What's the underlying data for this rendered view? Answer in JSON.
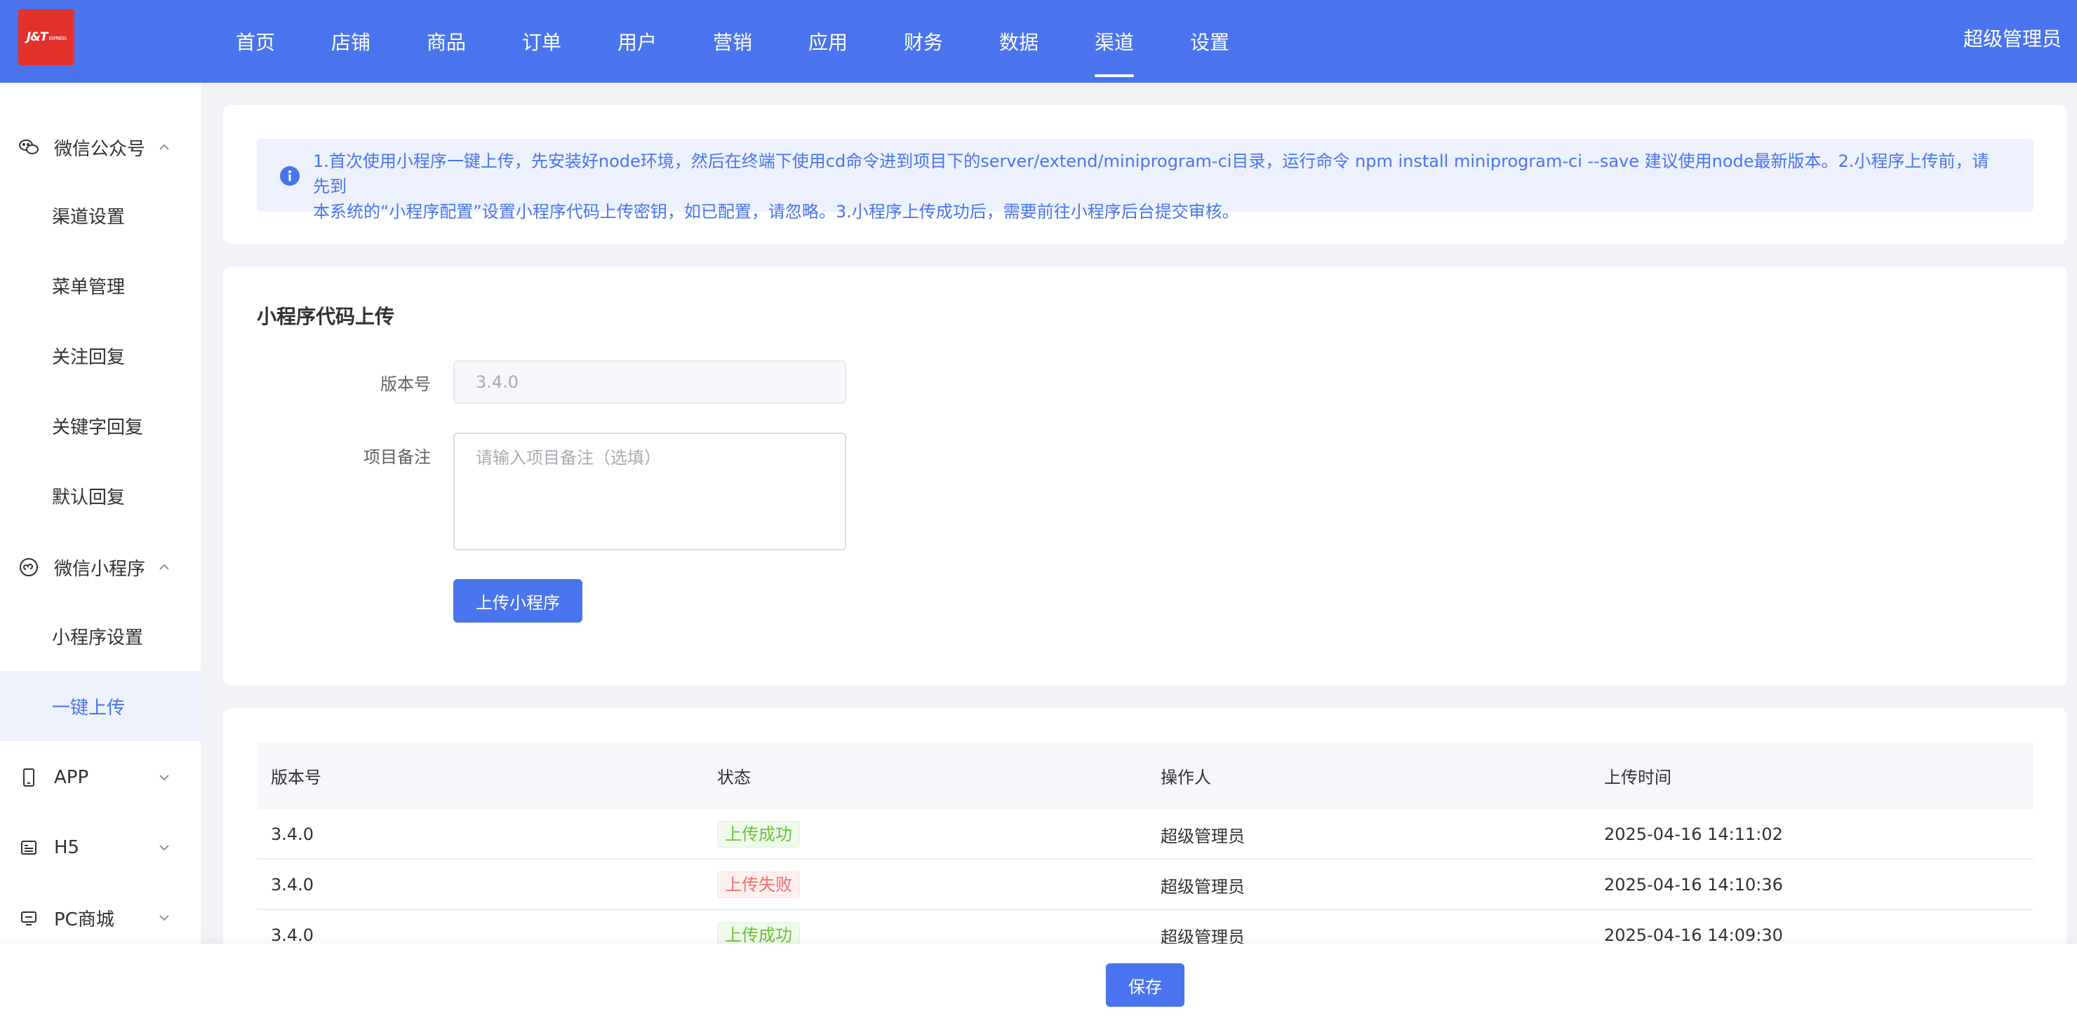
{
  "header": {
    "logo_text": "J&T",
    "logo_sub": "EXPRESS",
    "nav": [
      "首页",
      "店铺",
      "商品",
      "订单",
      "用户",
      "营销",
      "应用",
      "财务",
      "数据",
      "渠道",
      "设置"
    ],
    "active_nav": "渠道",
    "user": "超级管理员"
  },
  "sidebar": {
    "wechat_oa": {
      "label": "微信公众号",
      "icon": "wechat-icon",
      "items": [
        "渠道设置",
        "菜单管理",
        "关注回复",
        "关键字回复",
        "默认回复"
      ]
    },
    "wechat_mini": {
      "label": "微信小程序",
      "icon": "miniprogram-icon",
      "items": [
        "小程序设置",
        "一键上传"
      ]
    },
    "app": {
      "label": "APP",
      "icon": "tablet-icon"
    },
    "h5": {
      "label": "H5",
      "icon": "h5-icon"
    },
    "pc": {
      "label": "PC商城",
      "icon": "monitor-icon"
    },
    "active_item": "一键上传"
  },
  "notice": {
    "line1": "1.首次使用小程序一键上传，先安装好node环境，然后在终端下使用cd命令进到项目下的server/extend/miniprogram-ci目录，运行命令 npm install miniprogram-ci --save 建议使用node最新版本。2.小程序上传前，请先到",
    "line2": "本系统的“小程序配置”设置小程序代码上传密钥，如已配置，请忽略。3.小程序上传成功后，需要前往小程序后台提交审核。"
  },
  "upload_form": {
    "title": "小程序代码上传",
    "version_label": "版本号",
    "version_value": "3.4.0",
    "remark_label": "项目备注",
    "remark_placeholder": "请输入项目备注（选填）",
    "submit_label": "上传小程序"
  },
  "history_table": {
    "columns": [
      "版本号",
      "状态",
      "操作人",
      "上传时间"
    ],
    "rows": [
      {
        "version": "3.4.0",
        "status": "上传成功",
        "status_type": "success",
        "operator": "超级管理员",
        "time": "2025-04-16 14:11:02"
      },
      {
        "version": "3.4.0",
        "status": "上传失败",
        "status_type": "fail",
        "operator": "超级管理员",
        "time": "2025-04-16 14:10:36"
      },
      {
        "version": "3.4.0",
        "status": "上传成功",
        "status_type": "success",
        "operator": "超级管理员",
        "time": "2025-04-16 14:09:30"
      }
    ]
  },
  "footer": {
    "save_label": "保存"
  },
  "colors": {
    "primary": "#4a74ee",
    "logo_red": "#e4312b",
    "success": "#67c23a",
    "danger": "#f56c6c",
    "page_bg": "#f0f2f5"
  }
}
